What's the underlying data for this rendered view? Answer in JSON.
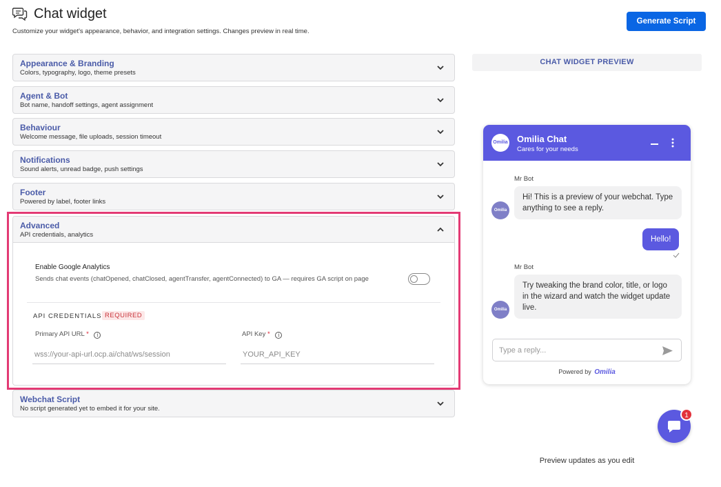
{
  "header": {
    "title": "Chat widget",
    "subtitle": "Customize your widget's appearance, behavior, and integration settings. Changes preview in real time.",
    "generate_button": "Generate Script",
    "icon": "chat-bubbles-icon"
  },
  "sections": [
    {
      "title": "Appearance & Branding",
      "desc": "Colors, typography, logo, theme presets"
    },
    {
      "title": "Agent & Bot",
      "desc": "Bot name, handoff settings, agent assignment"
    },
    {
      "title": "Behaviour",
      "desc": "Welcome message, file uploads, session timeout"
    },
    {
      "title": "Notifications",
      "desc": "Sound alerts, unread badge, push settings"
    },
    {
      "title": "Footer",
      "desc": "Powered by label, footer links"
    },
    {
      "title": "Advanced",
      "desc": "API credentials, analytics"
    },
    {
      "title": "Webchat Script",
      "desc": "No script generated yet to embed it for your site."
    }
  ],
  "advanced": {
    "ga_title": "Enable Google Analytics",
    "ga_desc": "Sends chat events (chatOpened, chatClosed, agentTransfer, agentConnected) to GA — requires GA script on page",
    "ga_enabled": false,
    "cred_title": "API CREDENTIALS",
    "cred_badge": "REQUIRED",
    "primary_url_label": "Primary API URL",
    "primary_url_placeholder": "wss://your-api-url.ocp.ai/chat/ws/session",
    "primary_url_value": "",
    "api_key_label": "API Key",
    "api_key_placeholder": "YOUR_API_KEY",
    "api_key_value": "",
    "required_mark": "*"
  },
  "preview": {
    "bar_label": "CHAT WIDGET PREVIEW",
    "chat_title": "Omilia Chat",
    "chat_subtitle": "Cares for your needs",
    "logo_text": "Omilia",
    "messages": [
      {
        "sender": "Mr Bot",
        "text": "Hi! This is a preview of your webchat. Type anything to see a reply."
      },
      {
        "sender": "user",
        "text": "Hello!"
      },
      {
        "sender": "Mr Bot",
        "text": "Try tweaking the brand color, title, or logo in the wizard and watch the widget update live."
      }
    ],
    "reply_placeholder": "Type a reply...",
    "powered_by": "Powered by",
    "powered_brand": "Omilia",
    "unread_count": "1",
    "footer_text": "Preview updates as you edit"
  },
  "colors": {
    "accent": "#5b59e0",
    "primary_button": "#0a66e4",
    "section_title": "#4a5ba8",
    "highlight_border": "#e33a74",
    "badge": "#e2323c"
  }
}
